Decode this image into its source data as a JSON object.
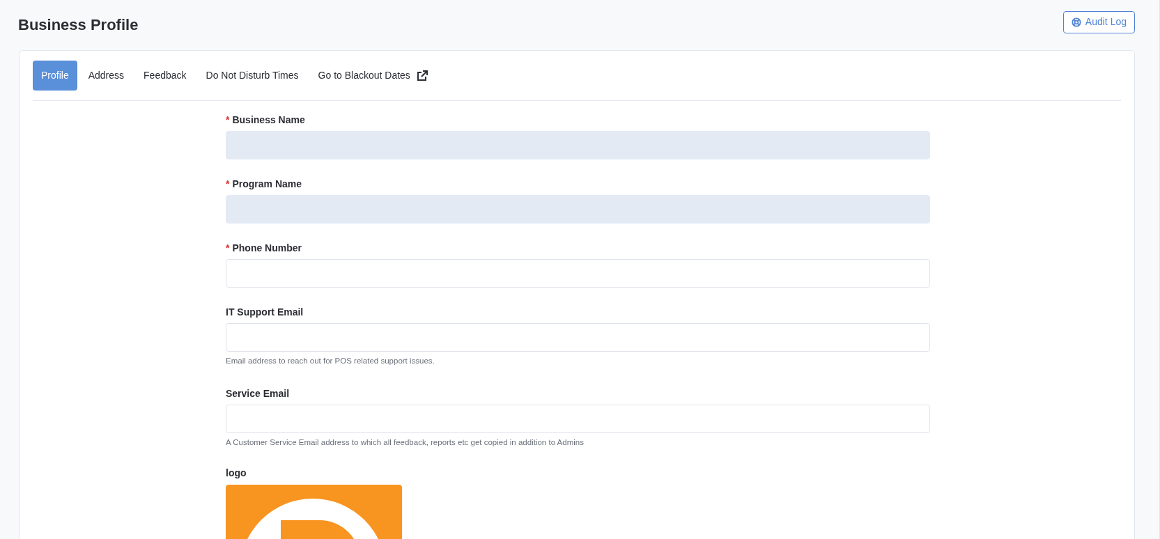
{
  "page": {
    "title": "Business Profile",
    "audit_button": "Audit Log"
  },
  "tabs": [
    {
      "label": "Profile",
      "selected": true,
      "external": false
    },
    {
      "label": "Address",
      "selected": false,
      "external": false
    },
    {
      "label": "Feedback",
      "selected": false,
      "external": false
    },
    {
      "label": "Do Not Disturb Times",
      "selected": false,
      "external": false
    },
    {
      "label": "Go to Blackout Dates",
      "selected": false,
      "external": true
    }
  ],
  "required_mark": "*",
  "fields": [
    {
      "label": "Business Name",
      "required": true,
      "disabled": true
    },
    {
      "label": "Program Name",
      "required": true,
      "disabled": true
    },
    {
      "label": "Phone Number",
      "required": true,
      "disabled": false
    },
    {
      "label": "IT Support Email",
      "required": false,
      "disabled": false,
      "help": "Email address to reach out for POS related support issues."
    },
    {
      "label": "Service Email",
      "required": false,
      "disabled": false,
      "help": "A Customer Service Email address to which all feedback, reports etc get copied in addition to Admins"
    }
  ],
  "logo": {
    "label": "logo"
  }
}
